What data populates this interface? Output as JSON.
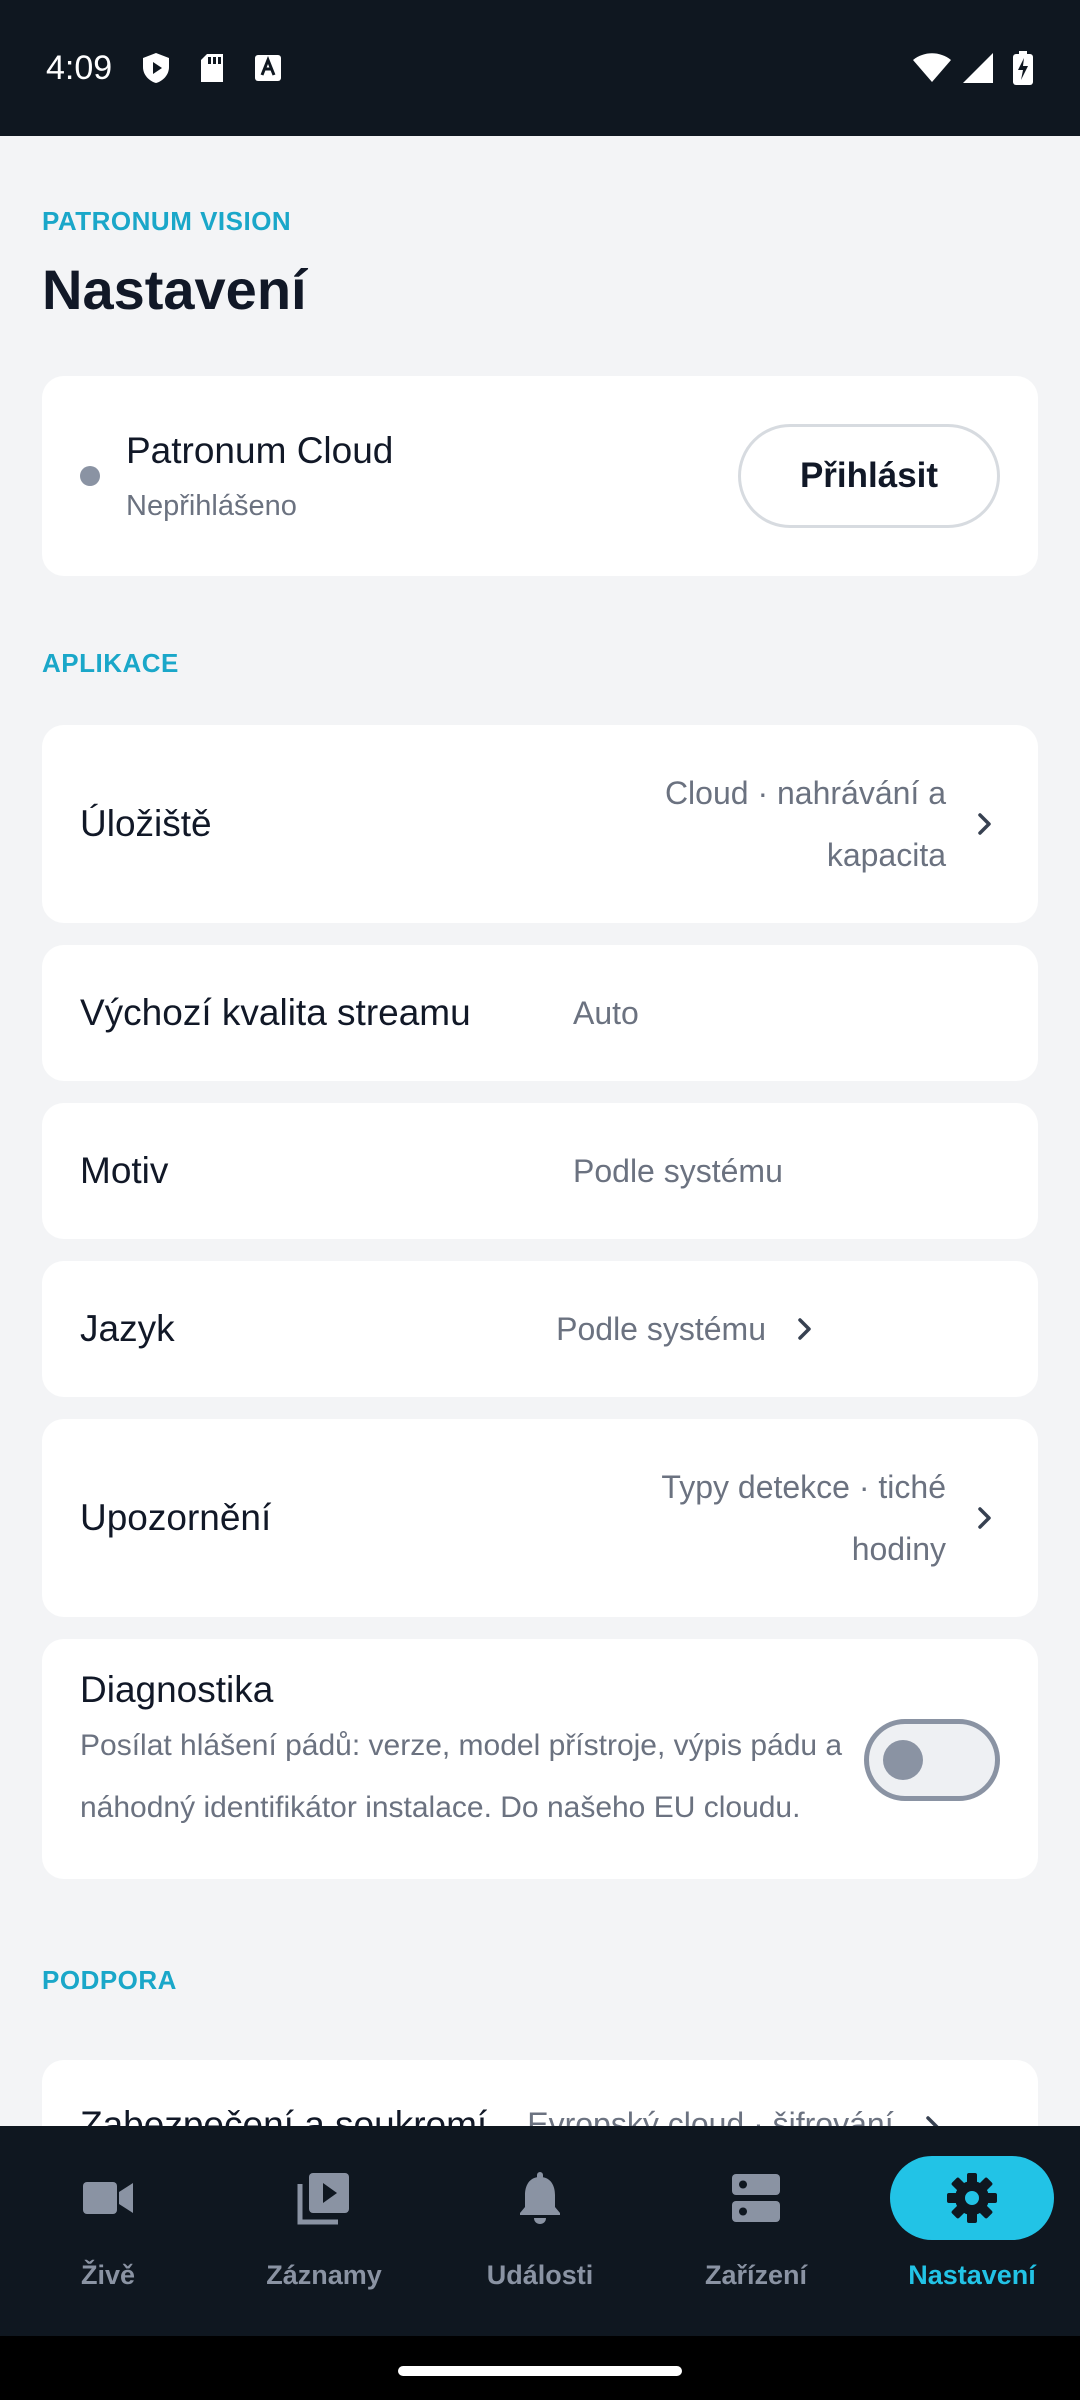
{
  "status_bar": {
    "time": "4:09",
    "left_icons": [
      "shield-play-icon",
      "sd-card-icon",
      "font-icon"
    ],
    "right_icons": [
      "wifi-icon",
      "signal-icon",
      "battery-charging-icon"
    ]
  },
  "header": {
    "brand": "PATRONUM VISION",
    "title": "Nastavení"
  },
  "cloud": {
    "name": "Patronum Cloud",
    "status": "Nepřihlášeno",
    "login_label": "Přihlásit"
  },
  "sections": {
    "app_label": "APLIKACE",
    "support_label": "PODPORA"
  },
  "settings": {
    "storage": {
      "label": "Úložiště",
      "value_line1": "Cloud · nahrávání a",
      "value_line2": "kapacita"
    },
    "quality": {
      "label": "Výchozí kvalita streamu",
      "value": "Auto"
    },
    "theme": {
      "label": "Motiv",
      "value": "Podle systému"
    },
    "language": {
      "label": "Jazyk",
      "value": "Podle systému"
    },
    "notifications": {
      "label": "Upozornění",
      "value_line1": "Typy detekce · tiché",
      "value_line2": "hodiny"
    },
    "diagnostics": {
      "label": "Diagnostika",
      "desc_line1": "Posílat hlášení pádů: verze, model přístroje, výpis pádu a",
      "desc_line2": "náhodný identifikátor instalace. Do našeho EU cloudu.",
      "enabled": false
    }
  },
  "support": {
    "privacy": {
      "label": "Zabezpečení a soukromí",
      "value": "Evropský cloud · šifrování"
    }
  },
  "nav": {
    "items": [
      {
        "label": "Živě",
        "icon": "video-camera-icon",
        "active": false
      },
      {
        "label": "Záznamy",
        "icon": "recordings-icon",
        "active": false
      },
      {
        "label": "Události",
        "icon": "bell-icon",
        "active": false
      },
      {
        "label": "Zařízení",
        "icon": "devices-icon",
        "active": false
      },
      {
        "label": "Nastavení",
        "icon": "gear-icon",
        "active": true
      }
    ]
  },
  "colors": {
    "accent": "#22c3e6",
    "section_label": "#1aa7c9",
    "dark_bar": "#0f1720",
    "background": "#f3f4f6"
  }
}
